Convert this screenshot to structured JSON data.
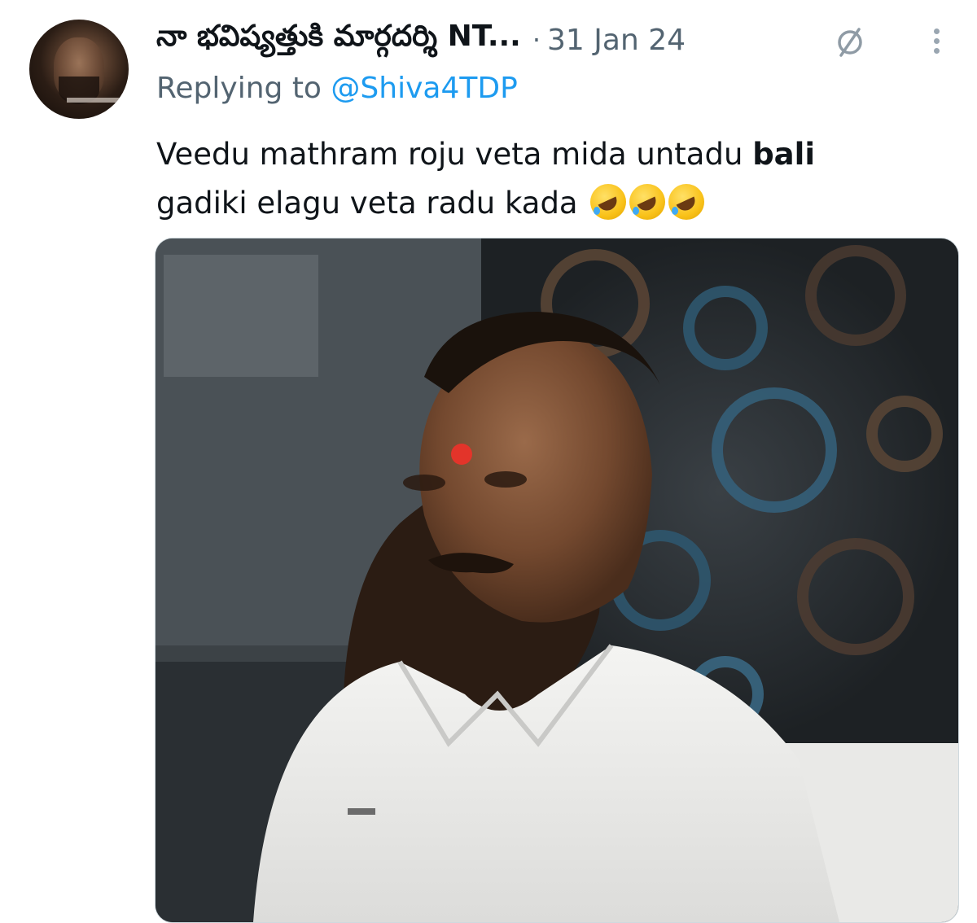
{
  "tweet": {
    "author_name": "నా భవిష్యత్తుకి మార్గదర్శి NT...",
    "separator": "·",
    "date": "31 Jan 24",
    "replying_prefix": "Replying to",
    "replying_handle": "@Shiva4TDP",
    "text_part1": "Veedu mathram roju veta mida untadu ",
    "text_bold": "bali",
    "text_part2": " gadiki elagu veta radu kada",
    "emoji_count": 3,
    "emoji_name": "rolling-on-the-floor-laughing"
  },
  "icons": {
    "edit_status": "slashed-circle-icon",
    "more": "vertical-ellipsis-icon"
  },
  "colors": {
    "primary_text": "#0f1419",
    "secondary_text": "#536471",
    "link": "#1d9bf0"
  }
}
